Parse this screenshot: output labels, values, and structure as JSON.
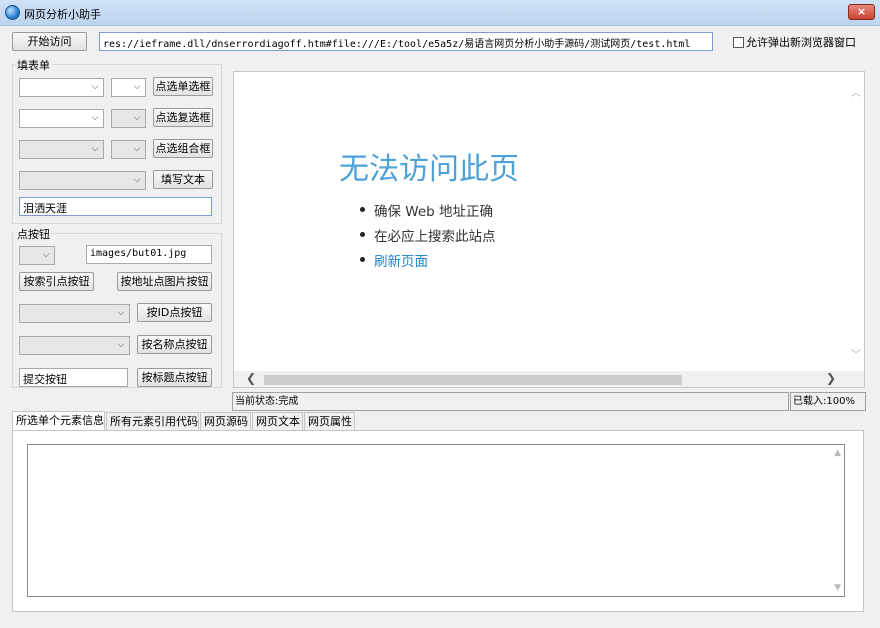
{
  "window": {
    "title": "网页分析小助手",
    "close": "×"
  },
  "toolbar": {
    "visit_label": "开始访问",
    "url": "res://ieframe.dll/dnserrordiagoff.htm#file:///E:/tool/e5a5z/易语言网页分析小助手源码/测试网页/test.html",
    "allow_popup_label": "允许弹出新浏览器窗口"
  },
  "fill_form": {
    "group_label": "填表单",
    "select_single_label": "点选单选框",
    "select_multi_label": "点选复选框",
    "select_combo_label": "点选组合框",
    "fill_text_label": "填写文本",
    "text_value": "泪洒天涯"
  },
  "click_button": {
    "group_label": "点按钮",
    "image_path": "images/but01.jpg",
    "by_index_label": "按索引点按钮",
    "by_image_label": "按地址点图片按钮",
    "by_id_label": "按ID点按钮",
    "by_name_label": "按名称点按钮",
    "title_value": "提交按钮",
    "by_title_label": "按标题点按钮"
  },
  "browser": {
    "error_title": "无法访问此页",
    "items": [
      "确保 Web 地址正确",
      "在必应上搜索此站点",
      "刷新页面"
    ]
  },
  "status": {
    "state": "当前状态:完成",
    "loaded": "已载入:100%"
  },
  "tabs": [
    "所选单个元素信息",
    "所有元素引用代码",
    "网页源码",
    "网页文本",
    "网页属性"
  ],
  "colors": {
    "error_title": "#4ea2d9",
    "link": "#1f86c8",
    "titlebar": "#c4d9f2",
    "close": "#c74431"
  }
}
